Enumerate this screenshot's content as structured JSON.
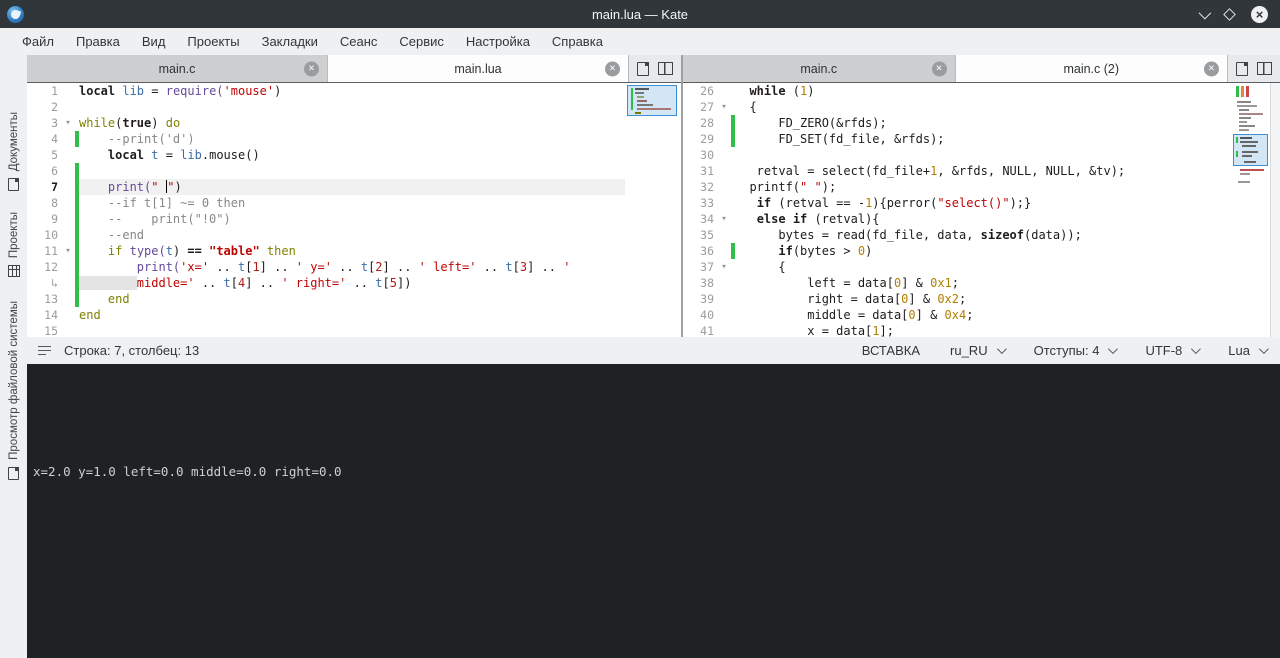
{
  "titlebar": {
    "title": "main.lua — Kate"
  },
  "menubar": {
    "items": [
      "Файл",
      "Правка",
      "Вид",
      "Проекты",
      "Закладки",
      "Сеанс",
      "Сервис",
      "Настройка",
      "Справка"
    ]
  },
  "sidebar": {
    "items": [
      {
        "label": "Документы",
        "icon": "document-icon"
      },
      {
        "label": "Проекты",
        "icon": "grid-icon"
      },
      {
        "label": "Просмотр файловой системы",
        "icon": "document-icon"
      }
    ]
  },
  "colors": {
    "accent_blue": "#3f8fd0",
    "modified_green": "#2fbe4a",
    "string_red": "#bf0303",
    "number_orange": "#b08000",
    "builtin_purple": "#644a9b",
    "control_olive": "#7f8000",
    "terminal_bg": "#1f2225",
    "titlebar_bg": "#31363b"
  },
  "left_pane": {
    "tabs": [
      {
        "label": "main.c",
        "active": false
      },
      {
        "label": "main.lua",
        "active": true
      }
    ],
    "lines": [
      {
        "num": "1",
        "tokens": [
          [
            "k",
            "local"
          ],
          [
            "p",
            " "
          ],
          [
            "v",
            "lib"
          ],
          [
            "p",
            " = "
          ],
          [
            "b",
            "require("
          ],
          [
            "s",
            "'mouse'"
          ],
          [
            "p",
            ")"
          ]
        ]
      },
      {
        "num": "2",
        "tokens": []
      },
      {
        "num": "3",
        "fold": true,
        "tokens": [
          [
            "c",
            "while"
          ],
          [
            "p",
            "("
          ],
          [
            "k",
            "true"
          ],
          [
            "p",
            ") "
          ],
          [
            "c",
            "do"
          ]
        ]
      },
      {
        "num": "4",
        "bar": true,
        "tokens": [
          [
            "m",
            "    --print('d')"
          ]
        ]
      },
      {
        "num": "5",
        "tokens": [
          [
            "p",
            "    "
          ],
          [
            "k",
            "local"
          ],
          [
            "p",
            " "
          ],
          [
            "v",
            "t"
          ],
          [
            "p",
            " = "
          ],
          [
            "v",
            "lib"
          ],
          [
            "p",
            ".mouse()"
          ]
        ]
      },
      {
        "num": "6",
        "bar": true,
        "tokens": []
      },
      {
        "num": "7",
        "bar": true,
        "current": true,
        "tokens": [
          [
            "p",
            "    "
          ],
          [
            "b",
            "print("
          ],
          [
            "s",
            "\" "
          ],
          [
            "u",
            ""
          ],
          [
            "s",
            "\""
          ],
          [
            "p",
            ")"
          ]
        ]
      },
      {
        "num": "8",
        "bar": true,
        "tokens": [
          [
            "m",
            "    --if t[1] ~= 0 then"
          ]
        ]
      },
      {
        "num": "9",
        "bar": true,
        "tokens": [
          [
            "m",
            "    --    print(\"!0\")"
          ]
        ]
      },
      {
        "num": "10",
        "bar": true,
        "tokens": [
          [
            "m",
            "    --end"
          ]
        ]
      },
      {
        "num": "11",
        "bar": true,
        "fold": true,
        "tokens": [
          [
            "p",
            "    "
          ],
          [
            "c",
            "if"
          ],
          [
            "p",
            " "
          ],
          [
            "b",
            "type("
          ],
          [
            "v",
            "t"
          ],
          [
            "p",
            ") "
          ],
          [
            "k",
            "=="
          ],
          [
            "p",
            " "
          ],
          [
            "t",
            "\"table\""
          ],
          [
            "p",
            " "
          ],
          [
            "c",
            "then"
          ]
        ]
      },
      {
        "num": "12",
        "bar": true,
        "tokens": [
          [
            "p",
            "        "
          ],
          [
            "b",
            "print("
          ],
          [
            "s",
            "'x='"
          ],
          [
            "p",
            " .. "
          ],
          [
            "v",
            "t"
          ],
          [
            "p",
            "["
          ],
          [
            "r",
            "1"
          ],
          [
            "p",
            "] .. "
          ],
          [
            "s",
            "' y='"
          ],
          [
            "p",
            " .. "
          ],
          [
            "v",
            "t"
          ],
          [
            "p",
            "["
          ],
          [
            "r",
            "2"
          ],
          [
            "p",
            "] .. "
          ],
          [
            "s",
            "' left='"
          ],
          [
            "p",
            " .. "
          ],
          [
            "v",
            "t"
          ],
          [
            "p",
            "["
          ],
          [
            "r",
            "3"
          ],
          [
            "p",
            "] .. "
          ],
          [
            "s",
            "'"
          ]
        ]
      },
      {
        "num": "",
        "wrap": true,
        "bar": true,
        "tokens": [
          [
            "f",
            "        "
          ],
          [
            "s",
            "middle='"
          ],
          [
            "p",
            " .. "
          ],
          [
            "v",
            "t"
          ],
          [
            "p",
            "["
          ],
          [
            "r",
            "4"
          ],
          [
            "p",
            "] .. "
          ],
          [
            "s",
            "' right='"
          ],
          [
            "p",
            " .. "
          ],
          [
            "v",
            "t"
          ],
          [
            "p",
            "["
          ],
          [
            "r",
            "5"
          ],
          [
            "p",
            "])"
          ]
        ]
      },
      {
        "num": "13",
        "bar": true,
        "tokens": [
          [
            "p",
            "    "
          ],
          [
            "c",
            "end"
          ]
        ]
      },
      {
        "num": "14",
        "tokens": [
          [
            "c",
            "end"
          ]
        ]
      },
      {
        "num": "15",
        "tokens": []
      }
    ]
  },
  "right_pane": {
    "tabs": [
      {
        "label": "main.c",
        "active": false
      },
      {
        "label": "main.c (2)",
        "active": true
      }
    ],
    "lines": [
      {
        "num": "26",
        "tokens": [
          [
            "p",
            "  "
          ],
          [
            "k",
            "while"
          ],
          [
            "p",
            " ("
          ],
          [
            "n",
            "1"
          ],
          [
            "p",
            ")"
          ]
        ]
      },
      {
        "num": "27",
        "fold": true,
        "tokens": [
          [
            "p",
            "  {"
          ]
        ]
      },
      {
        "num": "28",
        "bar": true,
        "tokens": [
          [
            "p",
            "      FD_ZERO(&rfds);"
          ]
        ]
      },
      {
        "num": "29",
        "bar": true,
        "tokens": [
          [
            "p",
            "      FD_SET(fd_file, &rfds);"
          ]
        ]
      },
      {
        "num": "30",
        "tokens": []
      },
      {
        "num": "31",
        "tokens": [
          [
            "p",
            "   retval = select(fd_file+"
          ],
          [
            "n",
            "1"
          ],
          [
            "p",
            ", &rfds, NULL, NULL, &tv);"
          ]
        ]
      },
      {
        "num": "32",
        "tokens": [
          [
            "p",
            "  printf("
          ],
          [
            "s",
            "\" \""
          ],
          [
            "p",
            ");"
          ]
        ]
      },
      {
        "num": "33",
        "tokens": [
          [
            "p",
            "   "
          ],
          [
            "k",
            "if"
          ],
          [
            "p",
            " (retval == -"
          ],
          [
            "n",
            "1"
          ],
          [
            "p",
            "){perror("
          ],
          [
            "s",
            "\"select()\""
          ],
          [
            "p",
            ");}"
          ]
        ]
      },
      {
        "num": "34",
        "fold": true,
        "tokens": [
          [
            "p",
            "   "
          ],
          [
            "k",
            "else"
          ],
          [
            "p",
            " "
          ],
          [
            "k",
            "if"
          ],
          [
            "p",
            " (retval){"
          ]
        ]
      },
      {
        "num": "35",
        "tokens": [
          [
            "p",
            "      bytes = read(fd_file, data, "
          ],
          [
            "k",
            "sizeof"
          ],
          [
            "p",
            "(data));"
          ]
        ]
      },
      {
        "num": "36",
        "bar": true,
        "tokens": [
          [
            "p",
            "      "
          ],
          [
            "k",
            "if"
          ],
          [
            "p",
            "(bytes > "
          ],
          [
            "n",
            "0"
          ],
          [
            "p",
            ")"
          ]
        ]
      },
      {
        "num": "37",
        "fold": true,
        "tokens": [
          [
            "p",
            "      {"
          ]
        ]
      },
      {
        "num": "38",
        "tokens": [
          [
            "p",
            "          left = data["
          ],
          [
            "n",
            "0"
          ],
          [
            "p",
            "] & "
          ],
          [
            "n",
            "0x1"
          ],
          [
            "p",
            ";"
          ]
        ]
      },
      {
        "num": "39",
        "tokens": [
          [
            "p",
            "          right = data["
          ],
          [
            "n",
            "0"
          ],
          [
            "p",
            "] & "
          ],
          [
            "n",
            "0x2"
          ],
          [
            "p",
            ";"
          ]
        ]
      },
      {
        "num": "40",
        "tokens": [
          [
            "p",
            "          middle = data["
          ],
          [
            "n",
            "0"
          ],
          [
            "p",
            "] & "
          ],
          [
            "n",
            "0x4"
          ],
          [
            "p",
            ";"
          ]
        ]
      },
      {
        "num": "41",
        "tokens": [
          [
            "p",
            "          x = data["
          ],
          [
            "n",
            "1"
          ],
          [
            "p",
            "];"
          ]
        ]
      }
    ]
  },
  "statusbar": {
    "line_col": "Строка: 7, столбец: 13",
    "mode": "ВСТАВКА",
    "dictionary": "ru_RU",
    "indentation": "Отступы: 4",
    "encoding": "UTF-8",
    "syntax": "Lua"
  },
  "terminal": {
    "output": "x=2.0 y=1.0 left=0.0 middle=0.0 right=0.0"
  }
}
